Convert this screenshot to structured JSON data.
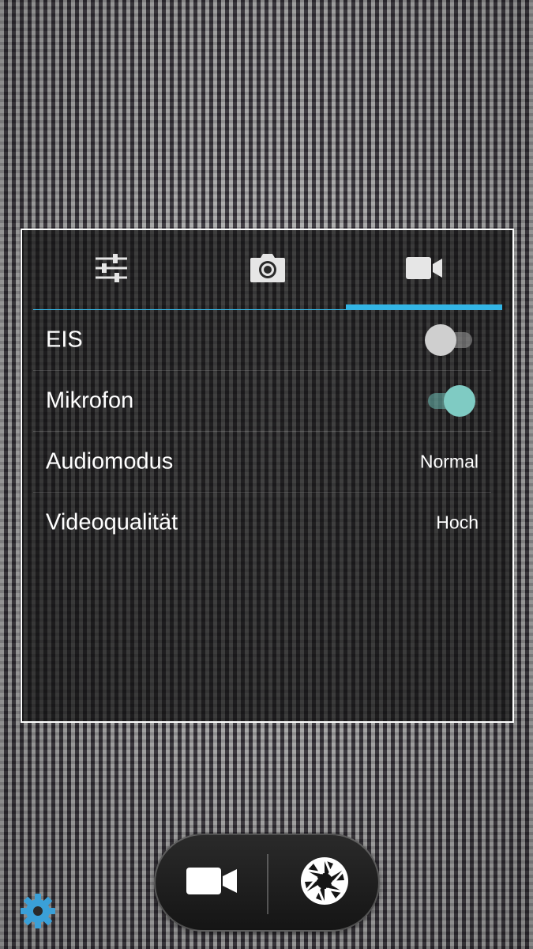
{
  "settings_panel": {
    "tabs": [
      {
        "icon": "sliders-icon",
        "active": false
      },
      {
        "icon": "camera-icon",
        "active": false
      },
      {
        "icon": "video-camera-icon",
        "active": true
      }
    ],
    "rows": {
      "eis": {
        "label": "EIS",
        "enabled": false
      },
      "mikrofon": {
        "label": "Mikrofon",
        "enabled": true
      },
      "audiomodus": {
        "label": "Audiomodus",
        "value": "Normal"
      },
      "videoqualitaet": {
        "label": "Videoqualität",
        "value": "Hoch"
      }
    }
  },
  "controls": {
    "mode_video_icon": "video-camera-icon",
    "mode_photo_icon": "shutter-icon",
    "settings_icon": "gear-icon"
  },
  "colors": {
    "accent": "#33b5e5",
    "toggle_on": "#7fcbc3",
    "gear": "#3aa0d8"
  }
}
